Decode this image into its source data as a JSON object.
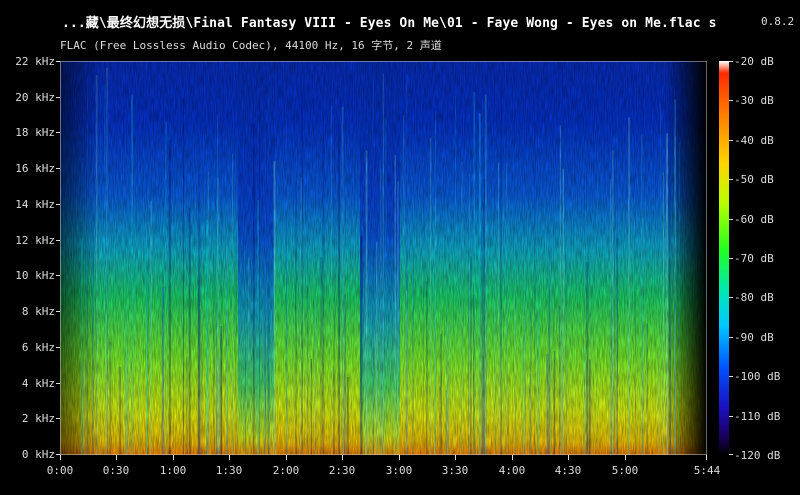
{
  "window": {
    "title": "...藏\\最终幻想无损\\Final Fantasy VIII - Eyes On Me\\01 - Faye Wong - Eyes on Me.flac",
    "app_name": "spek",
    "version": "0.8.2",
    "file_info": "FLAC (Free Lossless Audio Codec), 44100 Hz, 16 字节, 2 声道"
  },
  "axes": {
    "frequency_ticks": [
      "22 kHz",
      "20 kHz",
      "18 kHz",
      "16 kHz",
      "14 kHz",
      "12 kHz",
      "10 kHz",
      "8 kHz",
      "6 kHz",
      "4 kHz",
      "2 kHz",
      "0 kHz"
    ],
    "time_ticks": [
      "0:00",
      "0:30",
      "1:00",
      "1:30",
      "2:00",
      "2:30",
      "3:00",
      "3:30",
      "4:00",
      "4:30",
      "5:00",
      "5:44"
    ],
    "db_ticks": [
      "-20 dB",
      "-30 dB",
      "-40 dB",
      "-50 dB",
      "-60 dB",
      "-70 dB",
      "-80 dB",
      "-90 dB",
      "-100 dB",
      "-110 dB",
      "-120 dB"
    ]
  },
  "colors": {
    "background": "#000000",
    "text": "#ffffff",
    "spectrogram_low": "#0030ff",
    "spectrogram_mid": "#00ff40",
    "spectrogram_high": "#ffd000"
  }
}
